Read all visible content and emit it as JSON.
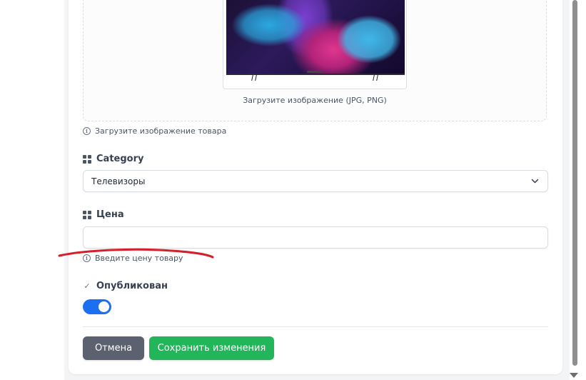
{
  "upload": {
    "hint": "Загрузите изображение (JPG, PNG)",
    "help_text": "Загрузите изображение товара",
    "preview_icon": "tv-preview-image"
  },
  "category": {
    "label": "Category",
    "value": "Телевизоры",
    "icon": "grid-icon"
  },
  "price": {
    "label": "Цена",
    "value": "",
    "placeholder": "",
    "help_text": "Введите цену товару",
    "icon": "grid-icon"
  },
  "published": {
    "label": "Опубликован",
    "enabled": true,
    "icon": "check-icon"
  },
  "actions": {
    "cancel_label": "Отмена",
    "save_label": "Сохранить изменения"
  },
  "colors": {
    "primary": "#1d6ff2",
    "success": "#22b55a",
    "secondary": "#5b616e",
    "annotation": "#d3202a"
  }
}
